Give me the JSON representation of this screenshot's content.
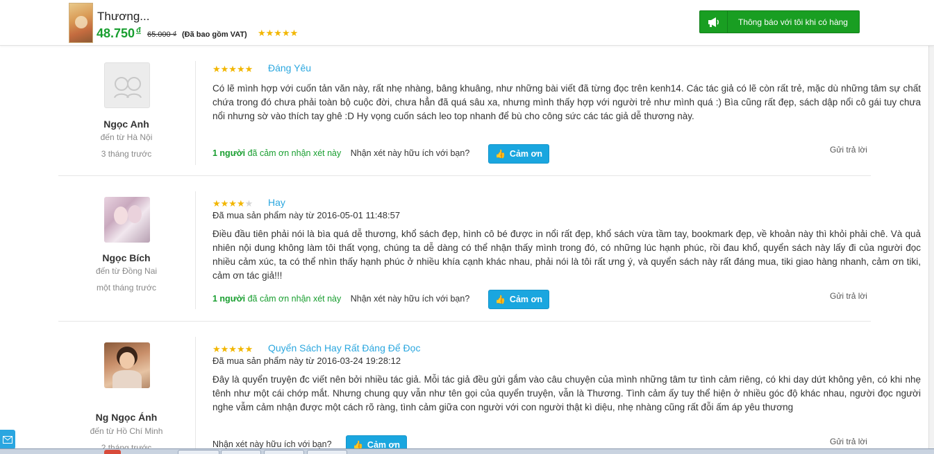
{
  "header": {
    "product_title": "Thương...",
    "price": "48.750",
    "currency": "đ",
    "old_price": "65.000 ₫",
    "vat_note": "(Đã bao gồm VAT)",
    "stars": "★★★★★",
    "notify_button": "Thông báo với tôi khi có hàng",
    "notify_icon": "megaphone-icon"
  },
  "reviews": [
    {
      "name": "Ngọc Anh",
      "from": "đến từ Hà Nội",
      "time": "3 tháng trước",
      "stars_on": "★★★★★",
      "stars_off": "",
      "title": "Đáng Yêu",
      "bought": "",
      "text": "Có lẽ mình hợp với cuốn tản văn này, rất nhẹ nhàng, bâng khuâng, như những bài viết đã từng đọc trên kenh14. Các tác giả có lẽ còn rất trẻ, mặc dù những tâm sự chất chứa trong đó chưa phải toàn bộ cuộc đời, chưa hẳn đã quá sâu xa, nhưng mình thấy hợp với người trẻ như mình quá :) Bìa cũng rất đẹp, sách dập nổi cô gái tuy chưa nổi nhưng sờ vào thích tay ghê :D Hy vọng cuốn sách leo top nhanh để bù cho công sức các tác giả dễ thương này.",
      "thanks_count": "1 người",
      "thanks_label": "đã cảm ơn nhận xét này",
      "helpful_q": "Nhận xét này hữu ích với bạn?",
      "thanks_btn": "Cảm ơn",
      "reply": "Gửi trả lời"
    },
    {
      "name": "Ngọc Bích",
      "from": "đến từ Đồng Nai",
      "time": "một tháng trước",
      "stars_on": "★★★★",
      "stars_off": "★",
      "title": "Hay",
      "bought": "Đã mua sản phẩm này từ 2016-05-01 11:48:57",
      "text": "Điều đầu tiên phải nói là bìa quá dễ thương, khổ sách đẹp, hình cô bé được in nổi rất đẹp, khổ sách vừa tầm tay, bookmark đẹp, về khoản này thì khỏi phải chê. Và quả nhiên nội dung không làm tôi thất vọng, chúng ta dễ dàng có thể nhận thấy mình trong đó, có những lúc hạnh phúc, rồi đau khổ, quyển sách này lấy đi của người đọc nhiều cảm xúc, ta có thể nhìn thấy hạnh phúc ở nhiều khía cạnh khác nhau, phải nói là tôi rất ưng ý, và quyển sách này rất đáng mua, tiki giao hàng nhanh, cảm ơn tiki, cảm ơn tác giả!!!",
      "thanks_count": "1 người",
      "thanks_label": "đã cảm ơn nhận xét này",
      "helpful_q": "Nhận xét này hữu ích với bạn?",
      "thanks_btn": "Cảm ơn",
      "reply": "Gửi trả lời"
    },
    {
      "name": "Ng Ngọc Ánh",
      "from": "đến từ Hồ Chí Minh",
      "time": "2 tháng trước",
      "stars_on": "★★★★★",
      "stars_off": "",
      "title": "Quyển Sách Hay Rất Đáng Để Đọc",
      "bought": "Đã mua sản phẩm này từ 2016-03-24 19:28:12",
      "text": "Đây là quyển truyện đc viết nên bởi nhiều tác giả. Mỗi tác giả đều gửi gắm vào câu chuyện của mình những tâm tư tình cảm riêng, có khi day dứt không yên, có khi nhẹ tênh như một cái chớp mắt. Nhưng chung quy vẫn như tên gọi của quyển truyện, vẫn là Thương. Tình cảm ấy tuy thể hiện ở nhiều góc độ khác nhau, người đọc người nghe vẫm cảm nhận được một cách rõ ràng, tình cảm giữa con người với con người thật kì diệu, nhẹ nhàng cũng rất đỗi ấm áp yêu thương",
      "thanks_count": "",
      "thanks_label": "",
      "helpful_q": "Nhận xét này hữu ích với bạn?",
      "thanks_btn": "Cảm ơn",
      "reply": "Gửi trả lời"
    }
  ],
  "colors": {
    "accent_blue": "#1aa6df",
    "price_green": "#189e2f",
    "star": "#f2b600"
  }
}
